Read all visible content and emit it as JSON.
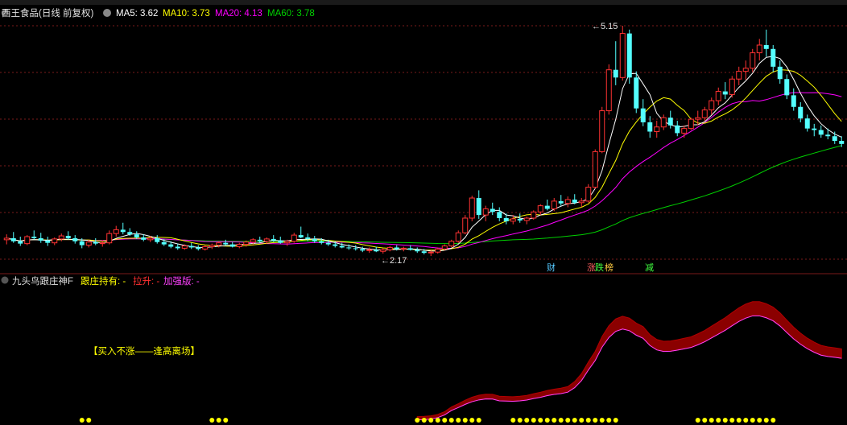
{
  "header": {
    "stock_title": "西王食品(日线 前复权)",
    "ma5_label": "MA5: 3.62",
    "ma10_label": "MA10: 3.73",
    "ma20_label": "MA20: 4.13",
    "ma60_label": "MA60: 3.78"
  },
  "colors": {
    "up": "#ff3232",
    "down": "#54ffff",
    "ma5": "#ffffff",
    "ma10": "#ffff00",
    "ma20": "#ff00ff",
    "ma60": "#00d000",
    "grid": "#7a1a1a",
    "band": "#8b0000",
    "yellow_dot": "#ffff00"
  },
  "annotations": {
    "high_label": "5.15",
    "low_label": "2.17",
    "event_cai": "财",
    "event_zhang": "涨",
    "event_die": "跌",
    "event_bang": "榜",
    "event_jian": "减"
  },
  "indicator": {
    "name": "九头鸟跟庄神F",
    "hold_label": "跟庄持有: -",
    "rise_label": "拉升: -",
    "strong_label": "加强版: -",
    "banner": "【买入不涨——逢高离场】"
  },
  "chart_data": {
    "type": "candlestick",
    "price_range": [
      2.17,
      5.15
    ],
    "candles": [
      [
        2.38,
        2.45,
        2.32,
        2.4
      ],
      [
        2.4,
        2.48,
        2.34,
        2.36
      ],
      [
        2.36,
        2.42,
        2.3,
        2.33
      ],
      [
        2.33,
        2.44,
        2.31,
        2.42
      ],
      [
        2.42,
        2.5,
        2.38,
        2.4
      ],
      [
        2.4,
        2.47,
        2.34,
        2.37
      ],
      [
        2.37,
        2.42,
        2.3,
        2.34
      ],
      [
        2.34,
        2.41,
        2.31,
        2.39
      ],
      [
        2.39,
        2.46,
        2.36,
        2.43
      ],
      [
        2.43,
        2.49,
        2.38,
        2.4
      ],
      [
        2.4,
        2.44,
        2.33,
        2.36
      ],
      [
        2.36,
        2.4,
        2.27,
        2.31
      ],
      [
        2.31,
        2.38,
        2.28,
        2.35
      ],
      [
        2.35,
        2.4,
        2.31,
        2.33
      ],
      [
        2.33,
        2.37,
        2.29,
        2.34
      ],
      [
        2.34,
        2.5,
        2.32,
        2.46
      ],
      [
        2.46,
        2.56,
        2.42,
        2.51
      ],
      [
        2.51,
        2.6,
        2.45,
        2.48
      ],
      [
        2.48,
        2.53,
        2.43,
        2.45
      ],
      [
        2.45,
        2.49,
        2.39,
        2.41
      ],
      [
        2.41,
        2.45,
        2.36,
        2.38
      ],
      [
        2.38,
        2.43,
        2.35,
        2.4
      ],
      [
        2.4,
        2.44,
        2.33,
        2.35
      ],
      [
        2.35,
        2.39,
        2.3,
        2.32
      ],
      [
        2.32,
        2.36,
        2.27,
        2.29
      ],
      [
        2.29,
        2.33,
        2.25,
        2.27
      ],
      [
        2.27,
        2.32,
        2.25,
        2.3
      ],
      [
        2.3,
        2.34,
        2.26,
        2.28
      ],
      [
        2.28,
        2.31,
        2.24,
        2.26
      ],
      [
        2.26,
        2.31,
        2.24,
        2.29
      ],
      [
        2.29,
        2.33,
        2.26,
        2.31
      ],
      [
        2.31,
        2.36,
        2.28,
        2.34
      ],
      [
        2.34,
        2.38,
        2.3,
        2.32
      ],
      [
        2.32,
        2.35,
        2.28,
        2.29
      ],
      [
        2.29,
        2.34,
        2.27,
        2.32
      ],
      [
        2.32,
        2.37,
        2.29,
        2.35
      ],
      [
        2.35,
        2.4,
        2.32,
        2.38
      ],
      [
        2.38,
        2.42,
        2.34,
        2.36
      ],
      [
        2.36,
        2.41,
        2.33,
        2.39
      ],
      [
        2.39,
        2.44,
        2.35,
        2.37
      ],
      [
        2.37,
        2.42,
        2.33,
        2.34
      ],
      [
        2.34,
        2.38,
        2.3,
        2.36
      ],
      [
        2.36,
        2.47,
        2.34,
        2.44
      ],
      [
        2.44,
        2.55,
        2.4,
        2.41
      ],
      [
        2.41,
        2.46,
        2.36,
        2.39
      ],
      [
        2.39,
        2.43,
        2.34,
        2.36
      ],
      [
        2.36,
        2.4,
        2.32,
        2.34
      ],
      [
        2.34,
        2.38,
        2.3,
        2.32
      ],
      [
        2.32,
        2.36,
        2.28,
        2.3
      ],
      [
        2.3,
        2.34,
        2.27,
        2.28
      ],
      [
        2.28,
        2.32,
        2.25,
        2.27
      ],
      [
        2.27,
        2.31,
        2.24,
        2.26
      ],
      [
        2.26,
        2.29,
        2.22,
        2.24
      ],
      [
        2.24,
        2.28,
        2.21,
        2.25
      ],
      [
        2.25,
        2.29,
        2.22,
        2.23
      ],
      [
        2.23,
        2.27,
        2.2,
        2.25
      ],
      [
        2.25,
        2.3,
        2.23,
        2.28
      ],
      [
        2.28,
        2.31,
        2.24,
        2.26
      ],
      [
        2.26,
        2.29,
        2.23,
        2.27
      ],
      [
        2.27,
        2.31,
        2.24,
        2.25
      ],
      [
        2.25,
        2.28,
        2.21,
        2.23
      ],
      [
        2.23,
        2.26,
        2.19,
        2.21
      ],
      [
        2.21,
        2.24,
        2.17,
        2.22
      ],
      [
        2.22,
        2.28,
        2.2,
        2.26
      ],
      [
        2.26,
        2.32,
        2.24,
        2.3
      ],
      [
        2.3,
        2.38,
        2.28,
        2.36
      ],
      [
        2.36,
        2.5,
        2.34,
        2.47
      ],
      [
        2.47,
        2.7,
        2.45,
        2.66
      ],
      [
        2.66,
        2.95,
        2.62,
        2.92
      ],
      [
        2.92,
        3.02,
        2.65,
        2.7
      ],
      [
        2.7,
        2.82,
        2.62,
        2.78
      ],
      [
        2.78,
        2.86,
        2.7,
        2.74
      ],
      [
        2.74,
        2.8,
        2.62,
        2.66
      ],
      [
        2.66,
        2.72,
        2.58,
        2.62
      ],
      [
        2.62,
        2.7,
        2.58,
        2.65
      ],
      [
        2.65,
        2.72,
        2.6,
        2.63
      ],
      [
        2.63,
        2.68,
        2.58,
        2.66
      ],
      [
        2.66,
        2.76,
        2.64,
        2.74
      ],
      [
        2.74,
        2.84,
        2.7,
        2.82
      ],
      [
        2.82,
        2.9,
        2.76,
        2.78
      ],
      [
        2.78,
        2.92,
        2.75,
        2.88
      ],
      [
        2.88,
        2.96,
        2.82,
        2.85
      ],
      [
        2.85,
        2.94,
        2.8,
        2.9
      ],
      [
        2.9,
        2.97,
        2.84,
        2.86
      ],
      [
        2.86,
        2.92,
        2.8,
        2.88
      ],
      [
        2.88,
        3.1,
        2.86,
        3.06
      ],
      [
        3.06,
        3.55,
        3.04,
        3.52
      ],
      [
        3.52,
        4.1,
        3.5,
        4.05
      ],
      [
        4.05,
        4.65,
        4.0,
        4.58
      ],
      [
        4.58,
        4.95,
        4.38,
        4.48
      ],
      [
        4.48,
        5.15,
        4.44,
        5.05
      ],
      [
        5.05,
        5.1,
        4.4,
        4.48
      ],
      [
        4.48,
        4.56,
        4.02,
        4.08
      ],
      [
        4.08,
        4.2,
        3.85,
        3.9
      ],
      [
        3.9,
        3.98,
        3.7,
        3.78
      ],
      [
        3.78,
        3.92,
        3.7,
        3.84
      ],
      [
        3.84,
        4.0,
        3.8,
        3.96
      ],
      [
        3.96,
        4.05,
        3.82,
        3.86
      ],
      [
        3.86,
        3.92,
        3.72,
        3.76
      ],
      [
        3.76,
        3.86,
        3.7,
        3.82
      ],
      [
        3.82,
        3.96,
        3.8,
        3.94
      ],
      [
        3.94,
        4.05,
        3.86,
        3.96
      ],
      [
        3.96,
        4.1,
        3.92,
        4.06
      ],
      [
        4.06,
        4.22,
        4.0,
        4.18
      ],
      [
        4.18,
        4.35,
        4.12,
        4.3
      ],
      [
        4.3,
        4.42,
        4.2,
        4.26
      ],
      [
        4.26,
        4.5,
        4.22,
        4.46
      ],
      [
        4.46,
        4.62,
        4.38,
        4.56
      ],
      [
        4.56,
        4.7,
        4.45,
        4.6
      ],
      [
        4.6,
        4.85,
        4.55,
        4.8
      ],
      [
        4.8,
        4.98,
        4.7,
        4.9
      ],
      [
        4.9,
        5.1,
        4.75,
        4.85
      ],
      [
        4.85,
        4.9,
        4.55,
        4.62
      ],
      [
        4.62,
        4.7,
        4.4,
        4.46
      ],
      [
        4.46,
        4.52,
        4.2,
        4.25
      ],
      [
        4.25,
        4.34,
        4.05,
        4.1
      ],
      [
        4.1,
        4.16,
        3.9,
        3.95
      ],
      [
        3.95,
        4.0,
        3.78,
        3.82
      ],
      [
        3.82,
        3.88,
        3.72,
        3.8
      ],
      [
        3.8,
        3.86,
        3.7,
        3.74
      ],
      [
        3.74,
        3.82,
        3.68,
        3.72
      ],
      [
        3.72,
        3.78,
        3.62,
        3.66
      ],
      [
        3.66,
        3.72,
        3.58,
        3.62
      ]
    ],
    "ma_lines": [
      "MA5",
      "MA10",
      "MA20",
      "MA60"
    ]
  }
}
